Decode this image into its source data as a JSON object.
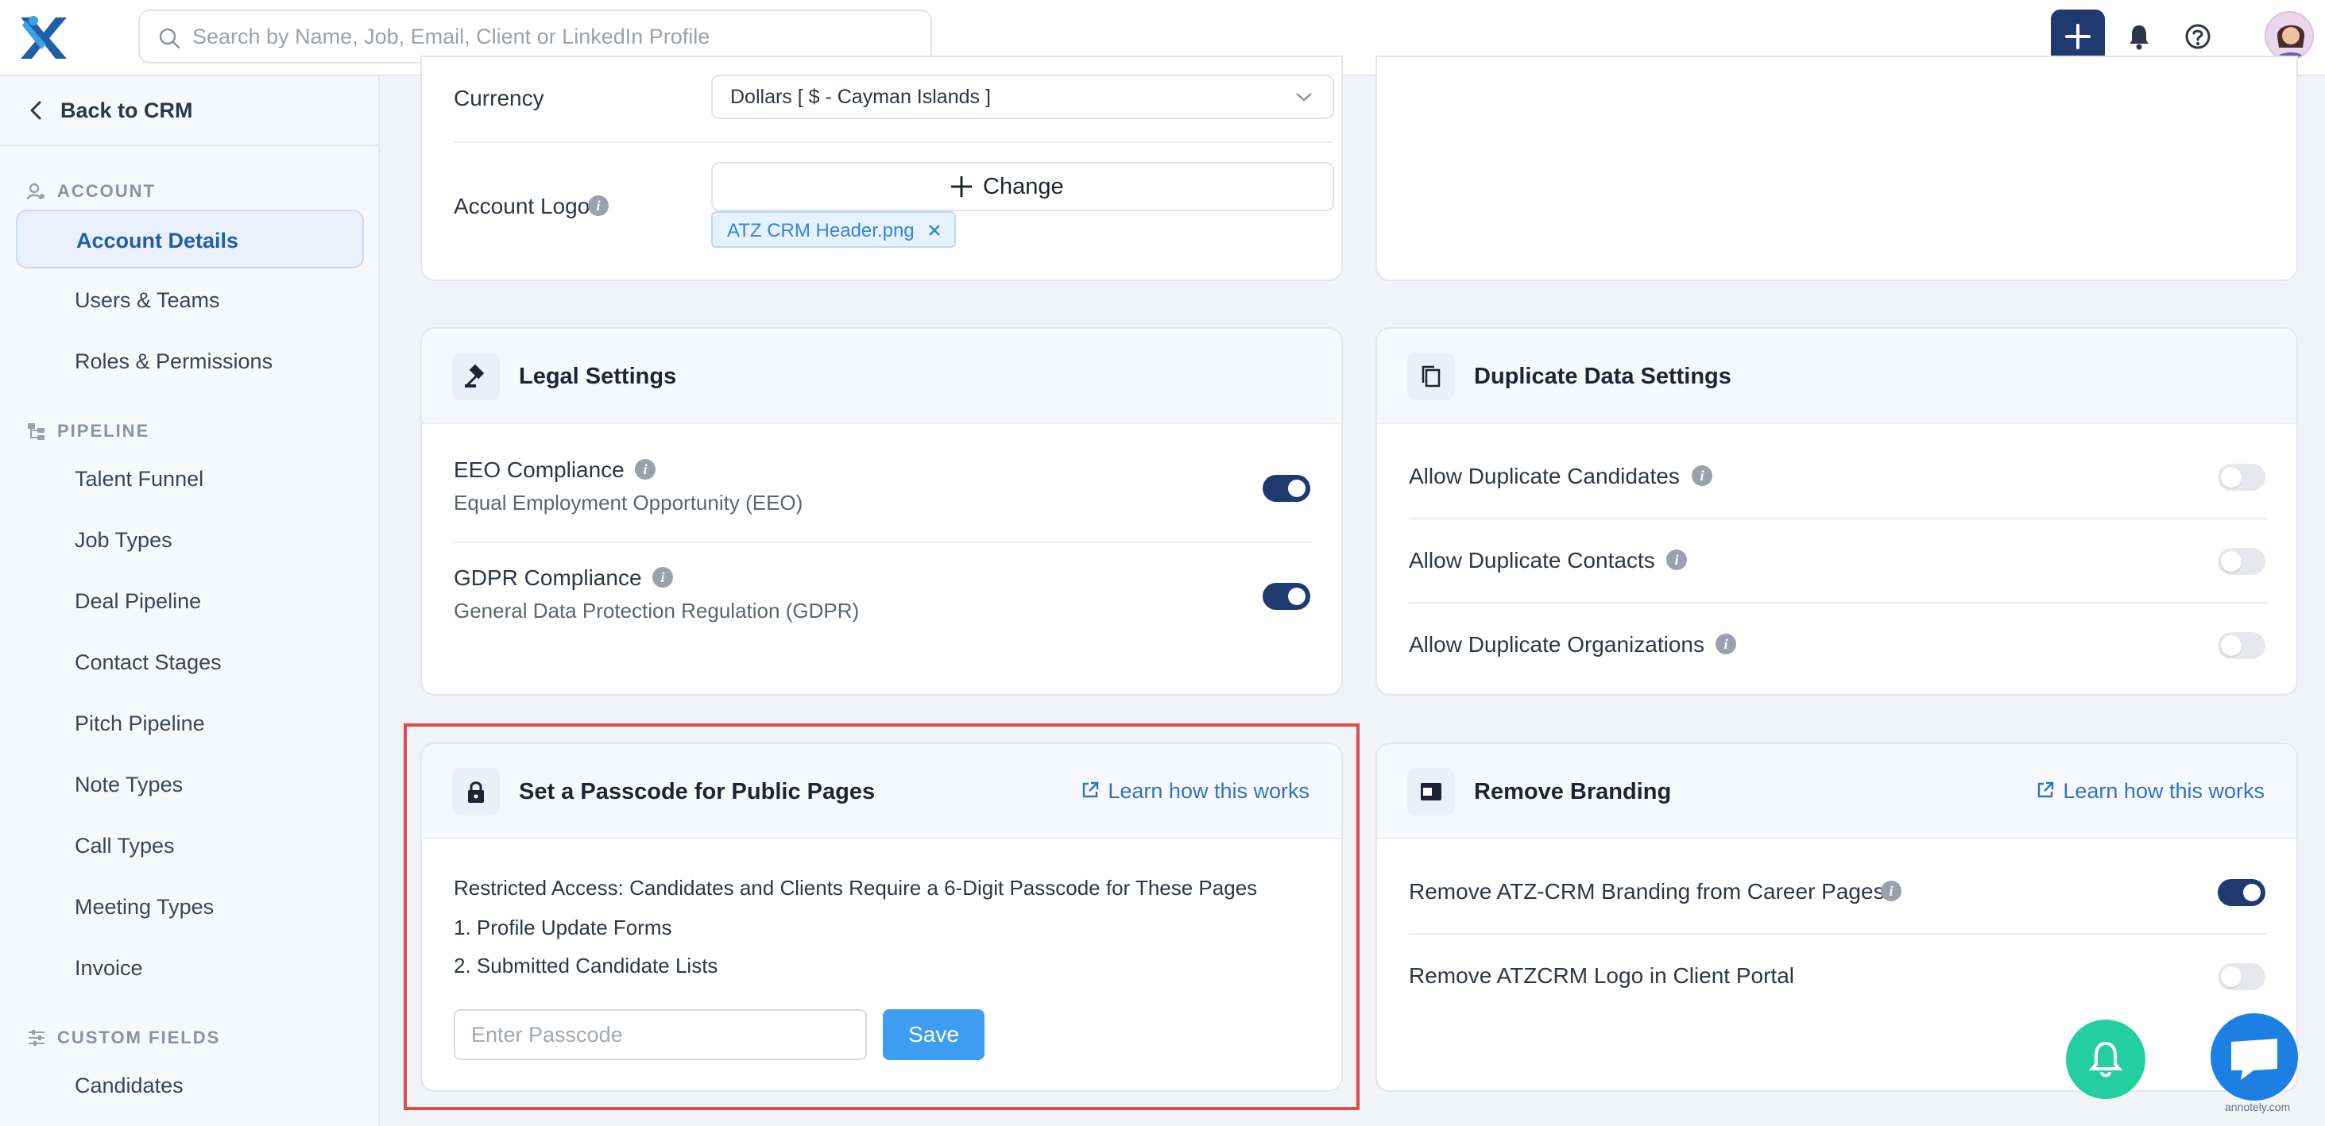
{
  "topbar": {
    "search_placeholder": "Search by Name, Job, Email, Client or LinkedIn Profile",
    "icons": [
      "logo-icon",
      "search-icon",
      "plus-icon",
      "bell-icon",
      "help-icon",
      "avatar"
    ],
    "accent_color": "#1e3a6e"
  },
  "sidebar": {
    "back_label": "Back to CRM",
    "sections": [
      {
        "title": "ACCOUNT",
        "items": [
          "Account Details",
          "Users & Teams",
          "Roles & Permissions"
        ]
      },
      {
        "title": "PIPELINE",
        "items": [
          "Talent Funnel",
          "Job Types",
          "Deal Pipeline",
          "Contact Stages",
          "Pitch Pipeline",
          "Note Types",
          "Call Types",
          "Meeting Types",
          "Invoice"
        ]
      },
      {
        "title": "CUSTOM FIELDS",
        "items": [
          "Candidates"
        ]
      }
    ],
    "active_item": "Account Details"
  },
  "account": {
    "currency_label": "Currency",
    "currency_value": "Dollars [ $ - Cayman Islands ]",
    "logo_label": "Account Logo",
    "change_label": "Change",
    "logo_file": "ATZ CRM Header.png"
  },
  "legal": {
    "title": "Legal Settings",
    "eeo_label": "EEO Compliance",
    "eeo_sub": "Equal Employment Opportunity (EEO)",
    "eeo_on": true,
    "gdpr_label": "GDPR Compliance",
    "gdpr_sub": "General Data Protection Regulation (GDPR)",
    "gdpr_on": true
  },
  "duplicate": {
    "title": "Duplicate Data Settings",
    "candidates_label": "Allow Duplicate Candidates",
    "contacts_label": "Allow Duplicate Contacts",
    "organizations_label": "Allow Duplicate Organizations",
    "candidates_on": false,
    "contacts_on": false,
    "organizations_on": false
  },
  "passcode": {
    "title": "Set a Passcode for Public Pages",
    "learn_label": "Learn how this works",
    "description": "Restricted Access: Candidates and Clients Require a 6-Digit Passcode for These Pages",
    "item1": "1. Profile Update Forms",
    "item2": "2. Submitted Candidate Lists",
    "input_placeholder": "Enter Passcode",
    "save_label": "Save"
  },
  "branding": {
    "title": "Remove Branding",
    "learn_label": "Learn how this works",
    "career_label": "Remove ATZ-CRM Branding from Career Pages",
    "career_on": true,
    "client_label": "Remove ATZCRM Logo in Client Portal",
    "client_on": false
  },
  "footer": {
    "watermark": "annotely.com"
  }
}
